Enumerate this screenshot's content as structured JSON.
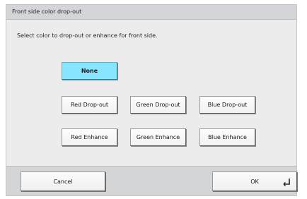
{
  "dialog": {
    "title": "Front side color drop-out",
    "instruction": "Select color to drop-out or enhance for front side."
  },
  "options": {
    "none": "None",
    "red_dropout": "Red Drop-out",
    "green_dropout": "Green Drop-out",
    "blue_dropout": "Blue Drop-out",
    "red_enhance": "Red Enhance",
    "green_enhance": "Green Enhance",
    "blue_enhance": "Blue Enhance",
    "selected": "None"
  },
  "footer": {
    "cancel_label": "Cancel",
    "ok_label": "OK"
  },
  "icons": {
    "ok": "enter-key-icon"
  },
  "colors": {
    "selected_button": "#87e5ff"
  }
}
